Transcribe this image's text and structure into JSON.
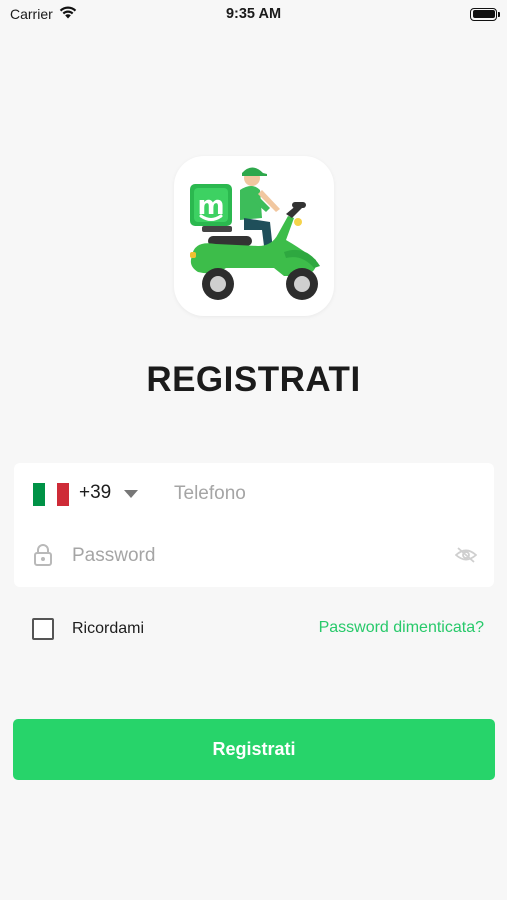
{
  "status_bar": {
    "carrier": "Carrier",
    "time": "9:35 AM",
    "wifi_icon": "wifi-icon",
    "battery_icon": "battery-icon"
  },
  "logo": {
    "icon": "delivery-scooter-logo",
    "brand_letter": "m"
  },
  "title": "REGISTRATI",
  "phone": {
    "flag_icon": "italy-flag-icon",
    "flag_colors": [
      "#009246",
      "#ffffff",
      "#ce2b37"
    ],
    "country_code": "+39",
    "placeholder": "Telefono",
    "value": ""
  },
  "password": {
    "icon": "lock-icon",
    "placeholder": "Password",
    "value": "",
    "toggle_icon": "eye-off-icon"
  },
  "remember": {
    "label": "Ricordami",
    "checked": false
  },
  "forgot_password_label": "Password dimenticata?",
  "submit_label": "Registrati",
  "colors": {
    "accent": "#27d46a",
    "link": "#27c96a",
    "background": "#f7f7f7"
  }
}
